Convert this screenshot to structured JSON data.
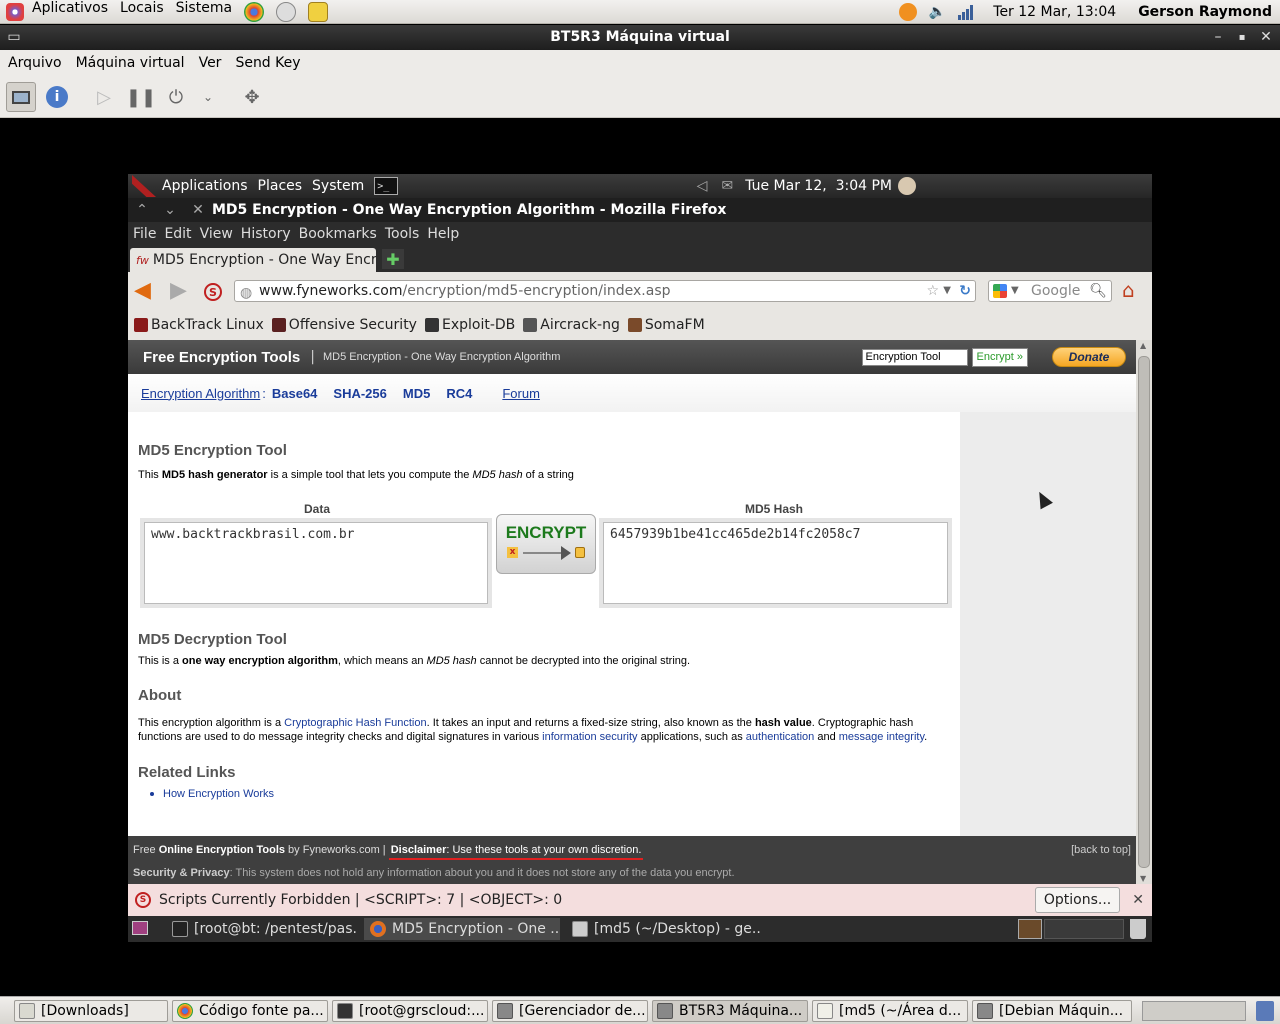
{
  "host_panel": {
    "menus": [
      "Aplicativos",
      "Locais",
      "Sistema"
    ],
    "clock": "Ter 12 Mar, 13:04",
    "user": "Gerson Raymond"
  },
  "vm_window": {
    "title": "BT5R3 Máquina virtual",
    "menus": [
      "Arquivo",
      "Máquina virtual",
      "Ver",
      "Send Key"
    ]
  },
  "guest": {
    "panel": {
      "menus": [
        "Applications",
        "Places",
        "System"
      ],
      "clock": "Tue Mar 12,  3:04 PM"
    },
    "window_title": "MD5 Encryption - One Way Encryption Algorithm - Mozilla Firefox",
    "menubar": [
      "File",
      "Edit",
      "View",
      "History",
      "Bookmarks",
      "Tools",
      "Help"
    ],
    "tab_label": "MD5 Encryption - One Way Encr...",
    "url_domain": "www.fyneworks.com",
    "url_path": "/encryption/md5-encryption/index.asp",
    "search_placeholder": "Google",
    "bookmarks": [
      "BackTrack Linux",
      "Offensive Security",
      "Exploit-DB",
      "Aircrack-ng",
      "SomaFM"
    ],
    "site": {
      "brand": "Free Encryption Tools",
      "separator": "|",
      "subtitle": "MD5 Encryption - One Way Encryption Algorithm",
      "search_value": "Encryption Tool",
      "encrypt_btn": "Encrypt »",
      "donate_btn": "Donate",
      "nav_label": "Encryption Algorithm",
      "nav_colon": ":",
      "nav_items": [
        "Base64",
        "SHA-256",
        "MD5",
        "RC4"
      ],
      "nav_forum": "Forum",
      "tool_heading": "MD5 Encryption Tool",
      "tool_intro_1": "This ",
      "tool_intro_b": "MD5 hash generator",
      "tool_intro_2": " is a simple tool that lets you compute the ",
      "tool_intro_i": "MD5 hash",
      "tool_intro_3": " of a string",
      "data_label": "Data",
      "hash_label": "MD5 Hash",
      "data_value": "www.backtrackbrasil.com.br",
      "hash_value": "6457939b1be41cc465de2b14fc2058c7",
      "encrypt_big": "ENCRYPT",
      "decrypt_heading": "MD5 Decryption Tool",
      "decrypt_1": "This is a ",
      "decrypt_b": "one way encryption algorithm",
      "decrypt_2": ", which means an ",
      "decrypt_i": "MD5 hash",
      "decrypt_3": " cannot be decrypted into the original string.",
      "about_heading": "About",
      "about_1": "This encryption algorithm is a ",
      "about_link1": "Cryptographic Hash Function",
      "about_2": ". It takes an input and returns a fixed-size string, also known as the ",
      "about_b": "hash value",
      "about_3": ". Cryptographic hash functions are used to do message integrity checks and digital signatures in various ",
      "about_link2": "information security",
      "about_4": " applications, such as ",
      "about_link3": "authentication",
      "about_5": " and ",
      "about_link4": "message integrity",
      "about_6": ".",
      "related_heading": "Related Links",
      "related_link": "How Encryption Works",
      "footer_1": "Free ",
      "footer_b": "Online Encryption Tools",
      "footer_2": " by Fyneworks.com | ",
      "footer_disclaimer_b": "Disclaimer",
      "footer_disclaimer": ": Use these tools at your own discretion.",
      "footer_back": "[back to top]",
      "footer_privacy_b": "Security & Privacy",
      "footer_privacy": ": This system does not hold any information about you and it does not store any of the data you encrypt."
    },
    "noscript": "Scripts Currently Forbidden | <SCRIPT>: 7 | <OBJECT>: 0",
    "noscript_options": "Options...",
    "taskbar": [
      "[root@bt: /pentest/pas...",
      "MD5 Encryption - One ...",
      "[md5 (~/Desktop) - ge..."
    ]
  },
  "host_taskbar": [
    "[Downloads]",
    "Código fonte pa...",
    "[root@grscloud:...",
    "[Gerenciador de...",
    "BT5R3 Máquina...",
    "[md5 (~/Área d...",
    "[Debian Máquin..."
  ],
  "colors": {
    "accent_orange": "#f5a623",
    "link_blue": "#1a3c9a",
    "encrypt_green": "#1d7a1d"
  }
}
